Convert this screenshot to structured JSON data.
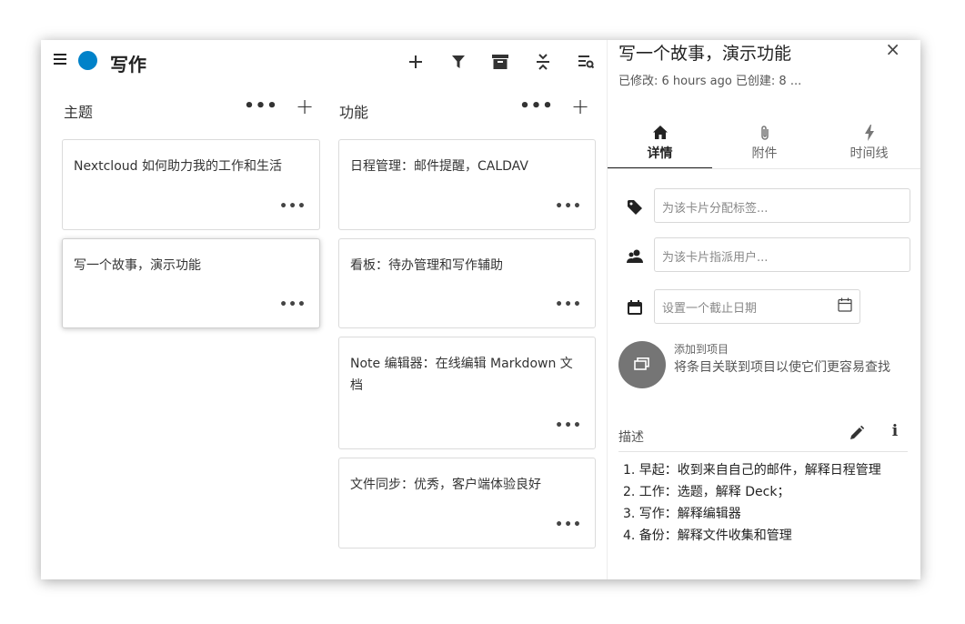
{
  "board": {
    "title": "写作",
    "color": "#0082c9"
  },
  "header_icons": [
    "add-icon",
    "filter-icon",
    "archive-icon",
    "collapse-icon",
    "details-icon"
  ],
  "stacks": [
    {
      "title": "主题",
      "more": "•••",
      "add": "+",
      "cards": [
        {
          "title": "Nextcloud 如何助力我的工作和生活",
          "more": "•••"
        },
        {
          "title": "写一个故事，演示功能",
          "more": "•••"
        }
      ]
    },
    {
      "title": "功能",
      "more": "•••",
      "add": "+",
      "cards": [
        {
          "title": "日程管理：邮件提醒，CALDAV",
          "more": "•••"
        },
        {
          "title": "看板：待办管理和写作辅助",
          "more": "•••"
        },
        {
          "title": "Note 编辑器：在线编辑 Markdown 文档",
          "more": "•••"
        },
        {
          "title": "文件同步：优秀，客户端体验良好",
          "more": "•••"
        }
      ]
    }
  ],
  "sidebar": {
    "title": "写一个故事，演示功能",
    "subtitle": "已修改: 6 hours ago 已创建: 8 ...",
    "close": "×",
    "tabs": [
      {
        "label": "详情",
        "icon": "home-icon"
      },
      {
        "label": "附件",
        "icon": "paperclip-icon"
      },
      {
        "label": "时间线",
        "icon": "lightning-icon"
      }
    ],
    "tags_placeholder": "为该卡片分配标签...",
    "assign_placeholder": "为该卡片指派用户...",
    "due_placeholder": "设置一个截止日期",
    "project_label": "添加到项目",
    "project_desc": "将条目关联到项目以使它们更容易查找",
    "description_label": "描述",
    "description": [
      "1. 早起：收到来自自己的邮件，解释日程管理",
      "2. 工作：选题，解释 Deck；",
      "3. 写作：解释编辑器",
      "4. 备份：解释文件收集和管理"
    ]
  }
}
